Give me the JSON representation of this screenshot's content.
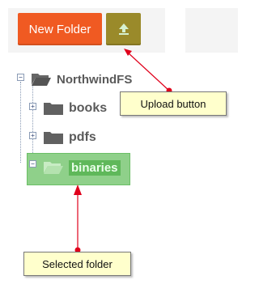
{
  "toolbar": {
    "new_folder_label": "New Folder",
    "upload_icon": "upload-arrow-icon"
  },
  "tree": {
    "root": {
      "label": "NorthwindFS",
      "toggle": "−",
      "icon": "folder-open-icon"
    },
    "children": [
      {
        "label": "books",
        "toggle": "+",
        "icon": "folder-icon"
      },
      {
        "label": "pdfs",
        "toggle": "+",
        "icon": "folder-icon"
      },
      {
        "label": "binaries",
        "toggle": "−",
        "icon": "folder-open-icon",
        "selected": true
      }
    ]
  },
  "annotations": {
    "upload": "Upload button",
    "selected": "Selected folder"
  },
  "colors": {
    "new_folder_bg": "#f05a22",
    "upload_bg": "#9a8a2a",
    "selected_bg": "#8fd08a",
    "callout_bg": "#ffffcc",
    "arrow": "#e0001b"
  }
}
